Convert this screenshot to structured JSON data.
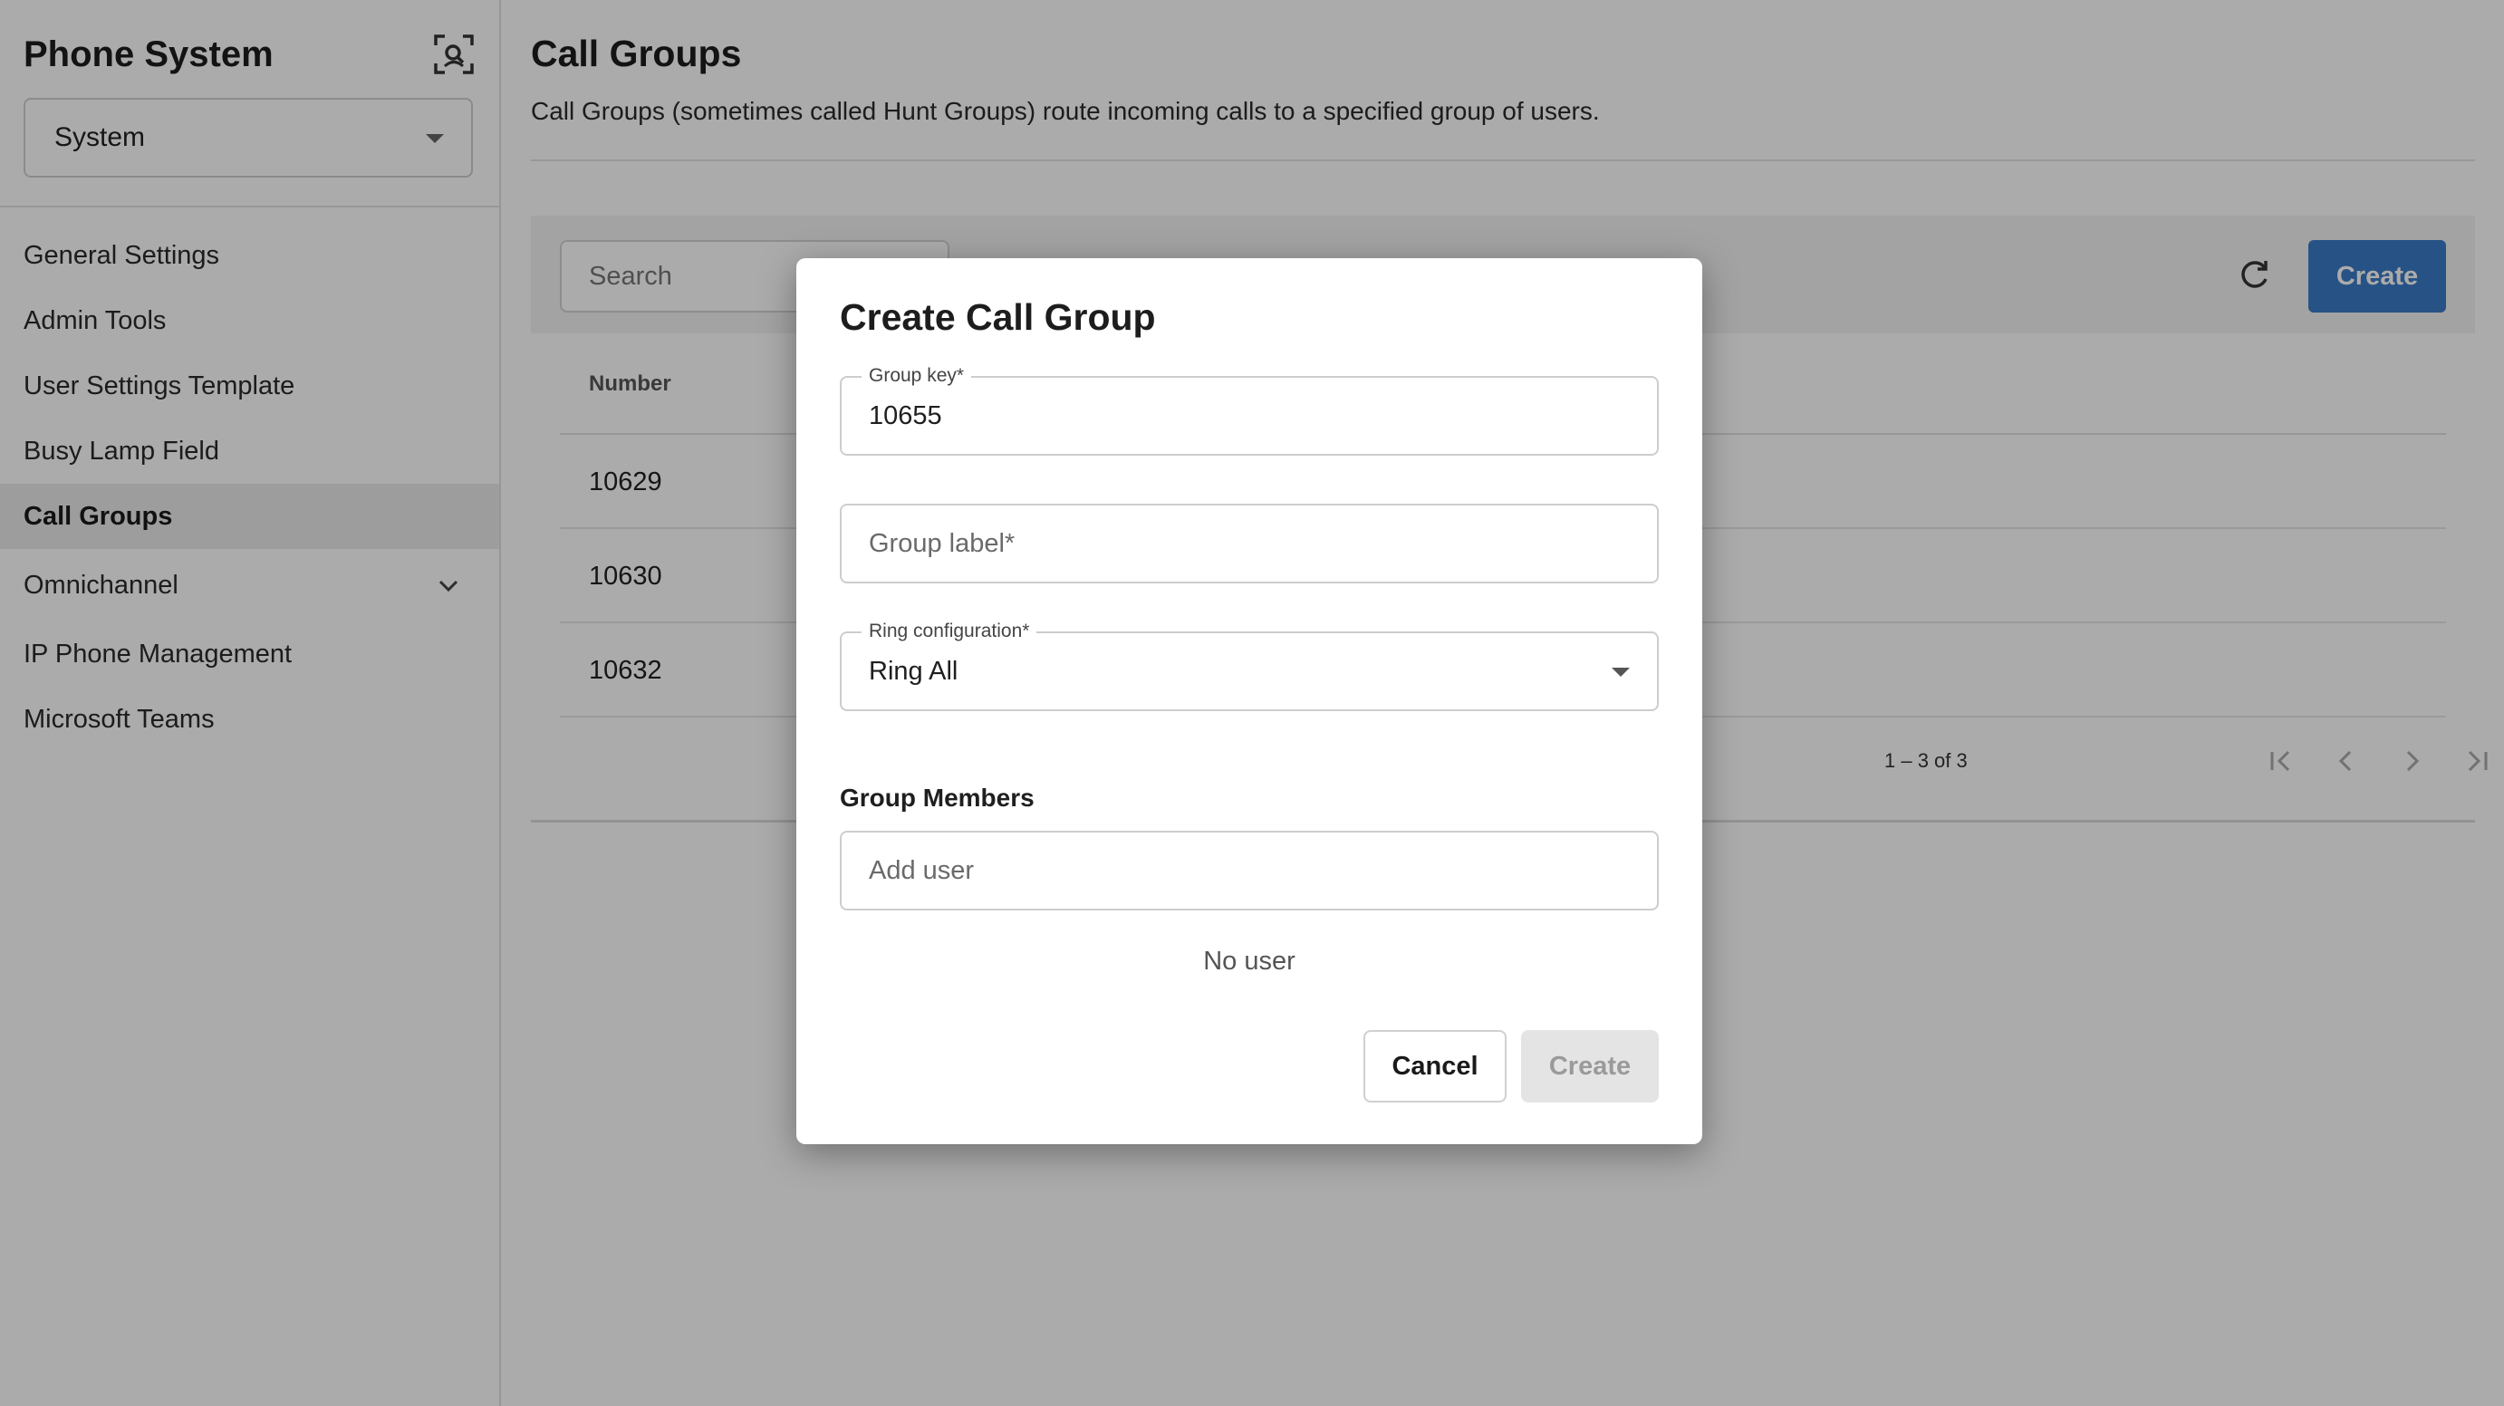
{
  "sidebar": {
    "app_title": "Phone System",
    "scan_icon": "scan-search-icon",
    "system_select": {
      "value": "System"
    },
    "items": [
      {
        "label": "General Settings",
        "active": false
      },
      {
        "label": "Admin Tools",
        "active": false
      },
      {
        "label": "User Settings Template",
        "active": false
      },
      {
        "label": "Busy Lamp Field",
        "active": false
      },
      {
        "label": "Call Groups",
        "active": true
      },
      {
        "label": "Omnichannel",
        "active": false,
        "expandable": true
      },
      {
        "label": "IP Phone Management",
        "active": false
      },
      {
        "label": "Microsoft Teams",
        "active": false
      }
    ]
  },
  "main": {
    "title": "Call Groups",
    "description": "Call Groups (sometimes called Hunt Groups) route incoming calls to a specified group of users.",
    "toolbar": {
      "search_placeholder": "Search",
      "refresh_icon": "refresh-icon",
      "create_label": "Create"
    },
    "table": {
      "columns": [
        "Number"
      ],
      "rows": [
        {
          "number": "10629"
        },
        {
          "number": "10630"
        },
        {
          "number": "10632"
        }
      ]
    },
    "pagination": {
      "range": "1 – 3 of 3"
    }
  },
  "dialog": {
    "title": "Create Call Group",
    "group_key": {
      "label": "Group key*",
      "value": "10655"
    },
    "group_label": {
      "placeholder": "Group label*"
    },
    "ring_config": {
      "label": "Ring configuration*",
      "value": "Ring All"
    },
    "members_title": "Group Members",
    "add_user_placeholder": "Add user",
    "empty_text": "No user",
    "cancel_label": "Cancel",
    "create_label": "Create"
  },
  "colors": {
    "accent": "#3b7bc7",
    "overlay": "rgba(0,0,0,0.33)",
    "active_nav_bg": "#ebebeb"
  }
}
